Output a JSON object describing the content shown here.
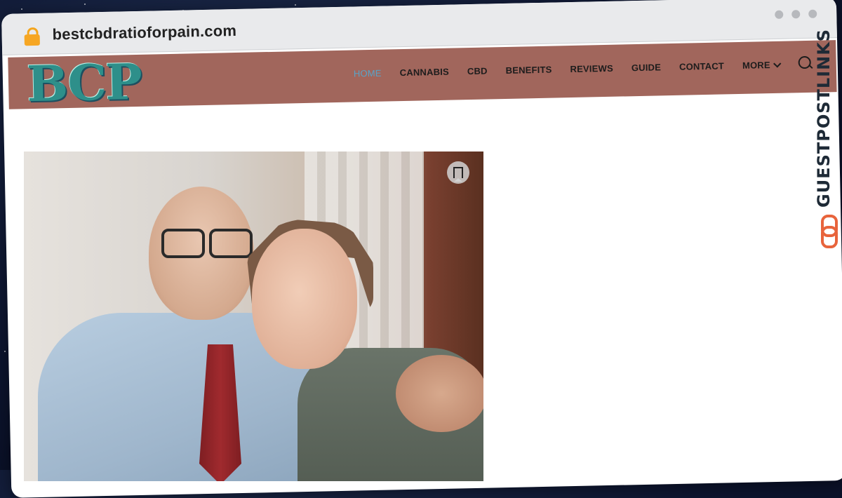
{
  "browser": {
    "url": "bestcbdratioforpain.com",
    "lock_icon": "lock-icon"
  },
  "site": {
    "logo_text": "BCP",
    "nav": [
      {
        "label": "HOME",
        "active": true
      },
      {
        "label": "CANNABIS"
      },
      {
        "label": "CBD"
      },
      {
        "label": "BENEFITS"
      },
      {
        "label": "REVIEWS"
      },
      {
        "label": "GUIDE"
      },
      {
        "label": "CONTACT"
      },
      {
        "label": "MORE"
      }
    ],
    "colors": {
      "navbar_bg": "#a1665c",
      "active_link": "#5aa3c7"
    }
  },
  "watermark": {
    "text": "GUESTPOSTLINKS"
  }
}
